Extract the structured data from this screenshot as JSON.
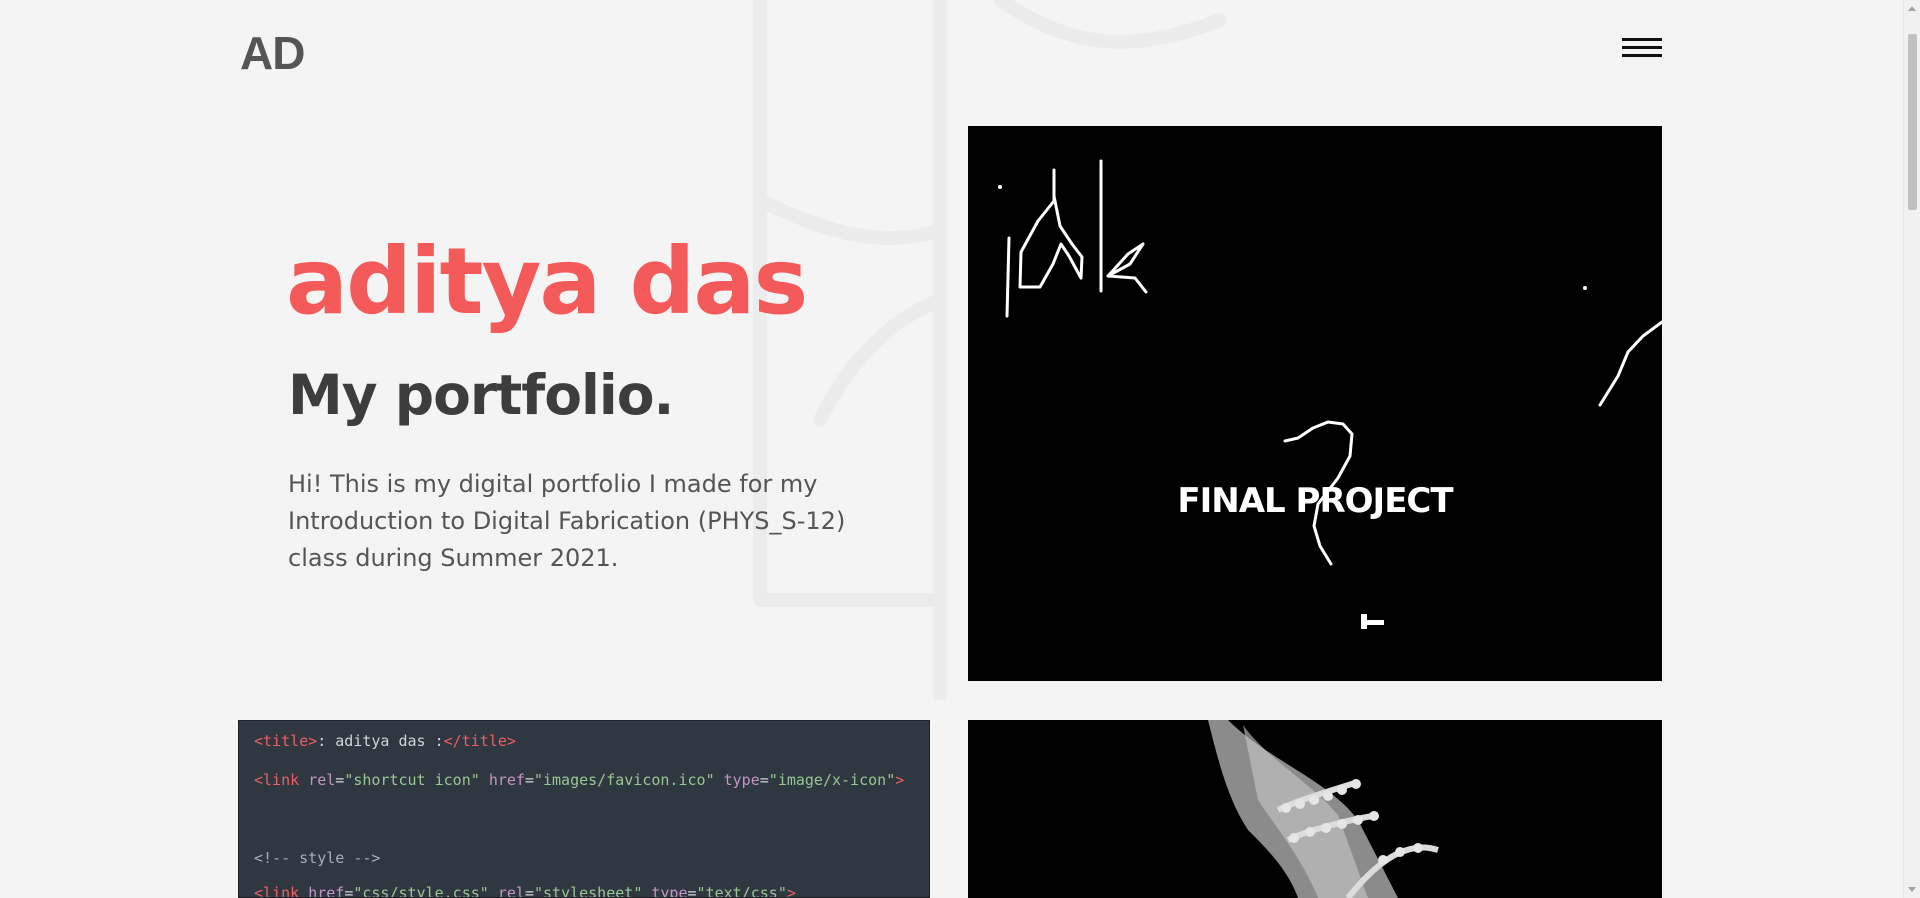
{
  "header": {
    "logo": "AD",
    "menu_icon": "hamburger-menu-icon"
  },
  "hero": {
    "name": "aditya das",
    "subtitle": "My portfolio.",
    "description": "Hi! This is my digital portfolio I made for my Introduction to Digital Fabrication (PHYS_S-12) class during Summer 2021."
  },
  "projects": {
    "final": {
      "label": "FINAL PROJECT"
    },
    "code_tile": {
      "lines": [
        {
          "tag": "title",
          "text": ": aditya das :"
        },
        {
          "tag": "link",
          "attrs": [
            [
              "rel",
              "shortcut icon"
            ],
            [
              "href",
              "images/favicon.ico"
            ],
            [
              "type",
              "image/x-icon"
            ]
          ]
        },
        {
          "comment": "<!-- style -->"
        },
        {
          "tag": "link",
          "attrs": [
            [
              "href",
              "css/style.css"
            ],
            [
              "rel",
              "stylesheet"
            ],
            [
              "type",
              "text/css"
            ]
          ]
        }
      ]
    }
  },
  "colors": {
    "accent": "#f55a5a",
    "heading": "#3d3d3d",
    "background": "#f4f4f4",
    "code_bg": "#2f3740"
  }
}
